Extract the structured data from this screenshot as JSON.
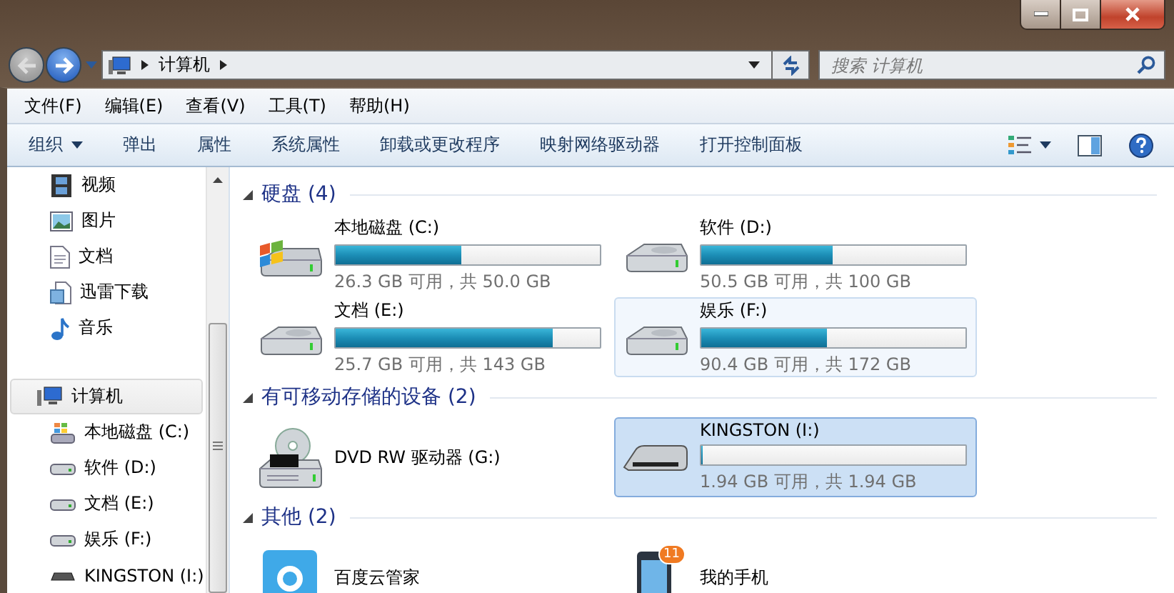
{
  "address_bar": {
    "path": [
      "计算机"
    ]
  },
  "search": {
    "placeholder": "搜索 计算机"
  },
  "menu": [
    "文件(F)",
    "编辑(E)",
    "查看(V)",
    "工具(T)",
    "帮助(H)"
  ],
  "toolbar": [
    {
      "label": "组织",
      "dropdown": true
    },
    {
      "label": "弹出",
      "dropdown": false
    },
    {
      "label": "属性",
      "dropdown": false
    },
    {
      "label": "系统属性",
      "dropdown": false
    },
    {
      "label": "卸载或更改程序",
      "dropdown": false
    },
    {
      "label": "映射网络驱动器",
      "dropdown": false
    },
    {
      "label": "打开控制面板",
      "dropdown": false
    }
  ],
  "sidebar": {
    "libraries": [
      {
        "label": "视频",
        "kind": "videos",
        "selected": false
      },
      {
        "label": "图片",
        "kind": "pictures",
        "selected": false
      },
      {
        "label": "文档",
        "kind": "documents",
        "selected": false
      },
      {
        "label": "迅雷下载",
        "kind": "downloads",
        "selected": false
      },
      {
        "label": "音乐",
        "kind": "music",
        "selected": false
      }
    ],
    "computer": {
      "label": "计算机",
      "selected": true,
      "children": [
        {
          "label": "本地磁盘 (C:)",
          "kind": "system_disk",
          "selected": false
        },
        {
          "label": "软件 (D:)",
          "kind": "disk",
          "selected": false
        },
        {
          "label": "文档 (E:)",
          "kind": "disk",
          "selected": false
        },
        {
          "label": "娱乐 (F:)",
          "kind": "disk",
          "selected": false
        },
        {
          "label": "KINGSTON (I:)",
          "kind": "usb",
          "selected": false
        }
      ]
    }
  },
  "sections": [
    {
      "title": "硬盘 (4)",
      "expanded": true,
      "items": [
        {
          "name": "本地磁盘 (C:)",
          "kind": "system_disk",
          "level": 0.474,
          "free": "26.3 GB 可用，共 50.0 GB",
          "selected": false,
          "hovered": false
        },
        {
          "name": "软件 (D:)",
          "kind": "disk",
          "level": 0.495,
          "free": "50.5 GB 可用，共 100 GB",
          "selected": false,
          "hovered": false
        },
        {
          "name": "文档 (E:)",
          "kind": "disk",
          "level": 0.82,
          "free": "25.7 GB 可用，共 143 GB",
          "selected": false,
          "hovered": false
        },
        {
          "name": "娱乐 (F:)",
          "kind": "disk",
          "level": 0.474,
          "free": "90.4 GB 可用，共 172 GB",
          "selected": false,
          "hovered": true
        }
      ]
    },
    {
      "title": "有可移动存储的设备 (2)",
      "expanded": true,
      "items": [
        {
          "name": "DVD RW 驱动器 (G:)",
          "kind": "optical",
          "selected": false,
          "hovered": false
        },
        {
          "name": "KINGSTON (I:)",
          "kind": "usb",
          "level": 0,
          "free": "1.94 GB 可用，共 1.94 GB",
          "selected": true,
          "hovered": false
        }
      ]
    },
    {
      "title": "其他 (2)",
      "expanded": true,
      "items": [
        {
          "name": "百度云管家",
          "kind": "cloud_app",
          "selected": false,
          "hovered": false
        },
        {
          "name": "我的手机",
          "kind": "phone",
          "badge": "11",
          "selected": false,
          "hovered": false
        }
      ]
    }
  ]
}
